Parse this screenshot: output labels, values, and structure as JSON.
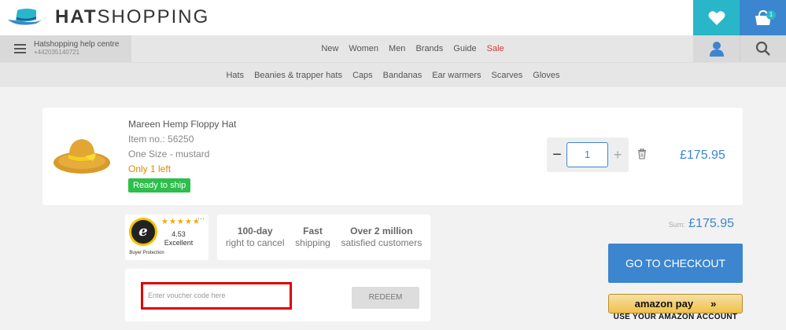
{
  "brand": {
    "bold": "HAT",
    "light": "SHOPPING"
  },
  "header": {
    "cart_count": "1"
  },
  "help": {
    "title": "Hatshopping help centre",
    "phone": "+442035140721"
  },
  "main_nav": [
    {
      "label": "New"
    },
    {
      "label": "Women"
    },
    {
      "label": "Men"
    },
    {
      "label": "Brands"
    },
    {
      "label": "Guide"
    },
    {
      "label": "Sale",
      "color": "#d23c3c"
    }
  ],
  "sub_nav": [
    {
      "label": "Hats"
    },
    {
      "label": "Beanies & trapper hats"
    },
    {
      "label": "Caps"
    },
    {
      "label": "Bandanas"
    },
    {
      "label": "Ear warmers"
    },
    {
      "label": "Scarves"
    },
    {
      "label": "Gloves"
    }
  ],
  "product": {
    "name": "Mareen Hemp Floppy Hat",
    "item_no": "Item no.: 56250",
    "variant": "One Size - mustard",
    "stock": "Only 1 left",
    "ship_badge": "Ready to ship",
    "quantity": "1",
    "minus": "−",
    "plus": "+",
    "price": "£175.95"
  },
  "trusted": {
    "stars": "★★★★★",
    "more": "···",
    "score": "4.53",
    "grade": "Excellent",
    "protection": "Buyer Protection",
    "seal_letter": "e"
  },
  "usps": [
    {
      "title": "100-day",
      "text": "right to cancel"
    },
    {
      "title": "Fast",
      "text": "shipping"
    },
    {
      "title": "Over 2 million",
      "text": "satisfied customers"
    }
  ],
  "voucher": {
    "placeholder": "Enter voucher code here",
    "button": "REDEEM"
  },
  "summary": {
    "label": "Sum:",
    "value": "£175.95"
  },
  "checkout": {
    "label": "GO TO CHECKOUT"
  },
  "amazon": {
    "label": "amazon pay",
    "arrows": "»",
    "sub": "USE YOUR AMAZON ACCOUNT"
  },
  "colors": {
    "accent": "#3b86cf",
    "teal": "#29b6c9",
    "sale": "#d23c3c",
    "ready": "#2dbe4b",
    "highlight": "#e00000"
  },
  "icons": [
    "hat-logo-icon",
    "heart-icon",
    "cart-icon",
    "menu-icon",
    "user-icon",
    "search-icon",
    "trash-icon"
  ]
}
